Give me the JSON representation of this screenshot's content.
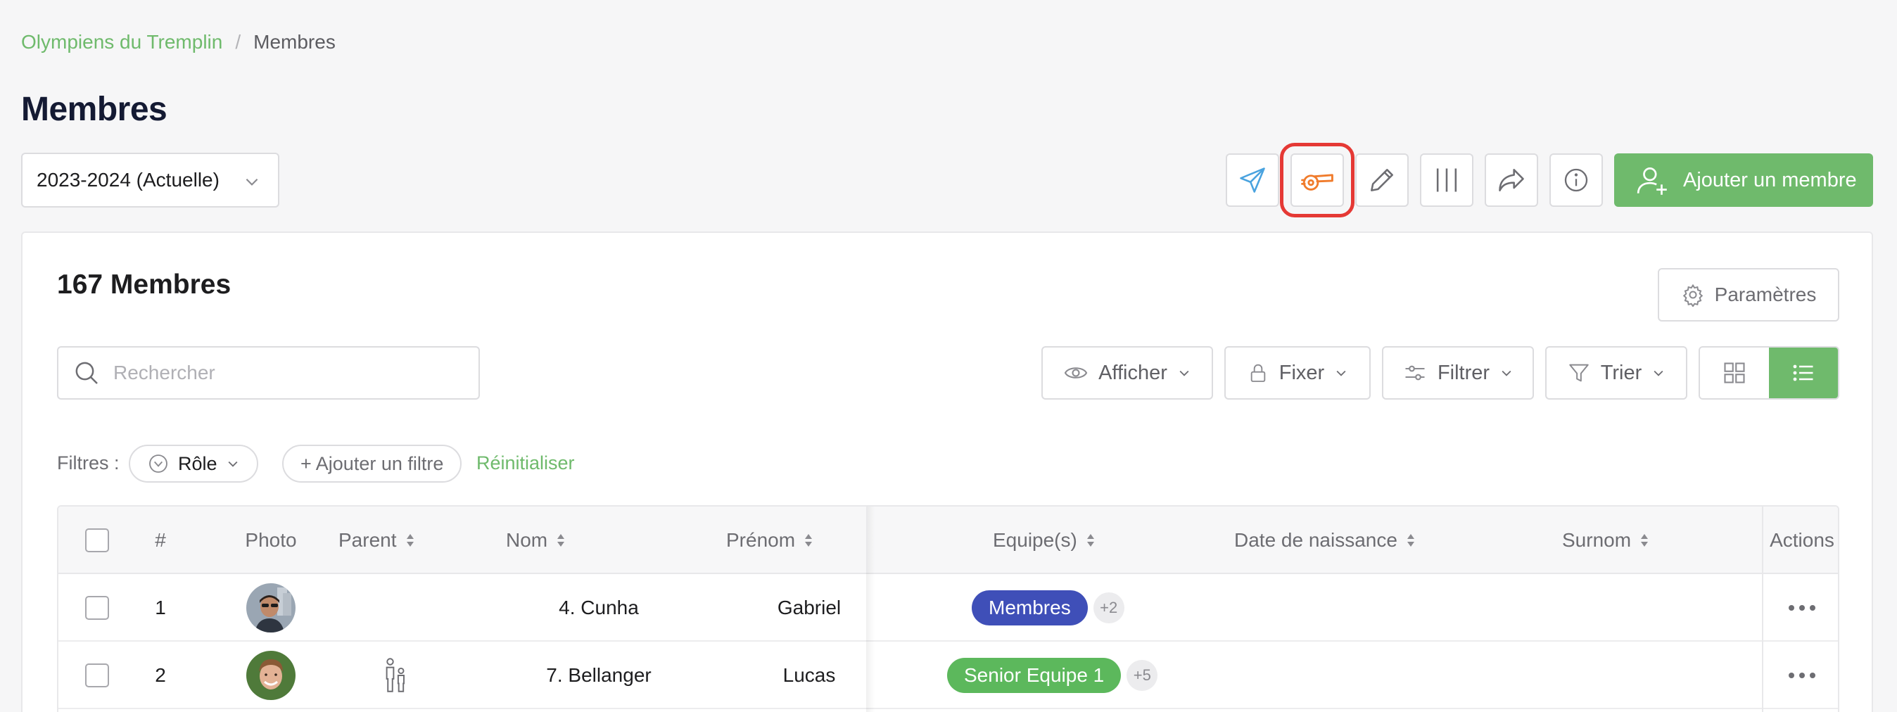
{
  "breadcrumb": {
    "club": "Olympiens du Tremplin",
    "separator": "/",
    "current": "Membres"
  },
  "page_title": "Membres",
  "season_select": {
    "value": "2023-2024 (Actuelle)"
  },
  "toolbar": {
    "buttons": [
      {
        "icon": "send-icon"
      },
      {
        "icon": "whistle-icon",
        "highlighted": true
      },
      {
        "icon": "pencil-icon"
      },
      {
        "icon": "columns-icon"
      },
      {
        "icon": "share-icon"
      },
      {
        "icon": "info-icon"
      }
    ],
    "add_member_label": "Ajouter un membre"
  },
  "card": {
    "count_title": "167 Membres",
    "params_label": "Paramètres",
    "search_placeholder": "Rechercher",
    "show_label": "Afficher",
    "pin_label": "Fixer",
    "filter_label": "Filtrer",
    "sort_label": "Trier"
  },
  "filters": {
    "label": "Filtres :",
    "role_label": "Rôle",
    "add_filter_label": "+ Ajouter un filtre",
    "reset_label": "Réinitialiser"
  },
  "table": {
    "headers": {
      "index": "#",
      "photo": "Photo",
      "parent": "Parent",
      "lastname": "Nom",
      "firstname": "Prénom",
      "teams": "Equipe(s)",
      "birthdate": "Date de naissance",
      "nickname": "Surnom",
      "actions": "Actions"
    },
    "rows": [
      {
        "index": "1",
        "lastname": "4. Cunha",
        "firstname": "Gabriel",
        "team": "Membres",
        "team_color": "#3f4fb8",
        "extra": "+2",
        "has_parent": false
      },
      {
        "index": "2",
        "lastname": "7. Bellanger",
        "firstname": "Lucas",
        "team": "Senior Equipe 1",
        "team_color": "#5cb85c",
        "extra": "+5",
        "has_parent": true
      }
    ]
  },
  "colors": {
    "accent": "#6fba6c",
    "highlight": "#e53935",
    "whistle": "#f07b2b"
  }
}
